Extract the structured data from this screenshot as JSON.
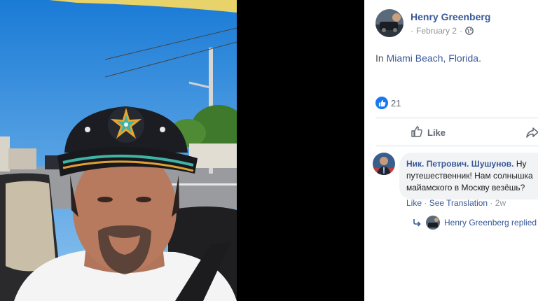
{
  "post": {
    "author": "Henry Greenberg",
    "date": "February 2",
    "meta_separator": "·",
    "text_prefix": "In ",
    "location": "Miami Beach, Florida",
    "text_suffix": "."
  },
  "reactions": {
    "count": "21"
  },
  "actions": {
    "like_label": "Like"
  },
  "comment": {
    "author": "Ник. Петрович. Шушунов.",
    "text": "Ну путешественник! Нам солнышка майамского в Москву везёшь?",
    "like": "Like",
    "see_translation": "See Translation",
    "separator": "·",
    "age": "2w"
  },
  "reply": {
    "name": "Henry Greenberg replied"
  },
  "colors": {
    "link": "#385898",
    "accent": "#1877f2",
    "background": "#000000"
  }
}
